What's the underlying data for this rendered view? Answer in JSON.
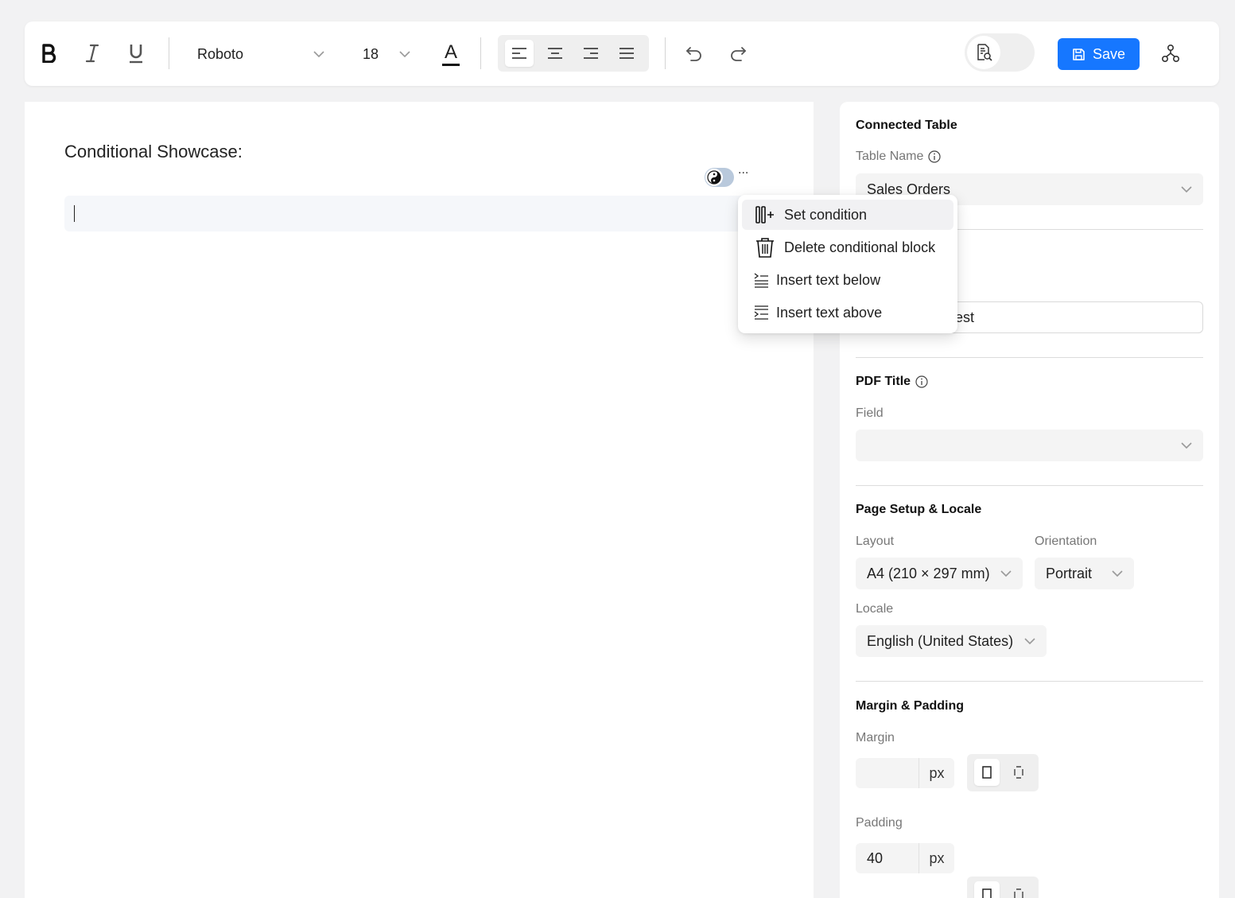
{
  "toolbar": {
    "font_family": "Roboto",
    "font_size": "18",
    "text_color_letter": "A",
    "save_label": "Save",
    "active_alignment": "left"
  },
  "editor": {
    "heading": "Conditional Showcase:",
    "more_label": "..."
  },
  "context_menu": {
    "items": [
      {
        "label": "Set condition",
        "icon": "add-column-icon"
      },
      {
        "label": "Delete conditional block",
        "icon": "trash-icon"
      },
      {
        "label": "Insert text below",
        "icon": "insert-below-icon"
      },
      {
        "label": "Insert text above",
        "icon": "insert-above-icon"
      }
    ]
  },
  "panel": {
    "connected_table": {
      "title": "Connected Table",
      "table_name_label": "Table Name",
      "table_name_value": "Sales Orders"
    },
    "hidden_field_visible_text": "est",
    "pdf_title": {
      "title": "PDF Title",
      "field_label": "Field",
      "field_value": ""
    },
    "page_setup": {
      "title": "Page Setup & Locale",
      "layout_label": "Layout",
      "layout_value": "A4 (210 × 297 mm)",
      "orientation_label": "Orientation",
      "orientation_value": "Portrait",
      "locale_label": "Locale",
      "locale_value": "English (United States)"
    },
    "margin_padding": {
      "title": "Margin & Padding",
      "margin_label": "Margin",
      "margin_value": "",
      "margin_unit": "px",
      "padding_label": "Padding",
      "padding_value": "40",
      "padding_unit": "px"
    }
  },
  "colors": {
    "accent": "#1677ff",
    "toggle": "#b9c9dc"
  }
}
